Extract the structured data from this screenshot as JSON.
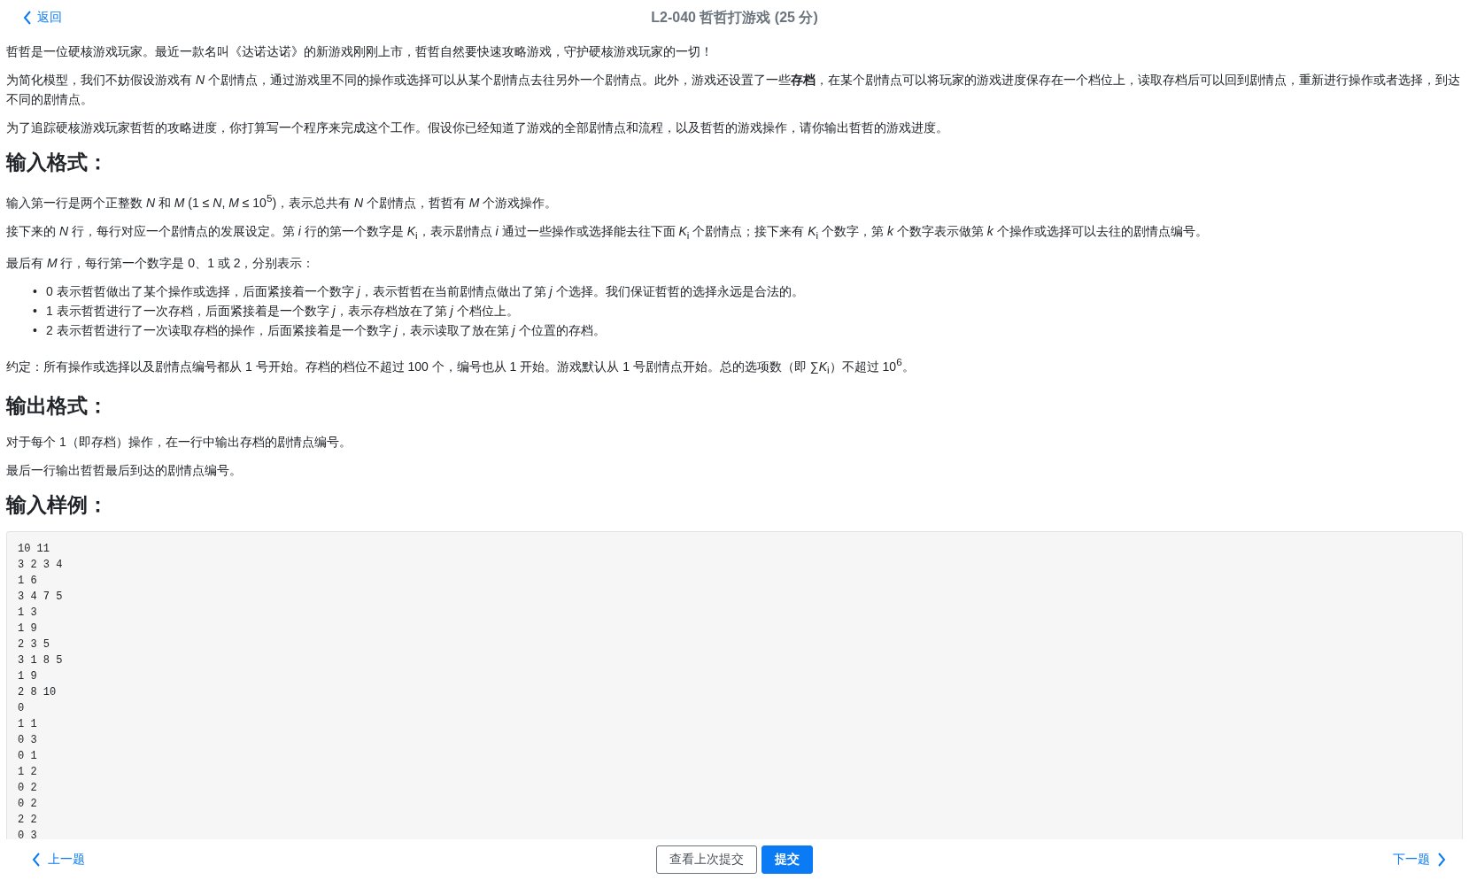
{
  "header": {
    "back": "返回",
    "title": "L2-040 哲哲打游戏 (25 分)"
  },
  "content": [
    {
      "kind": "paragraph",
      "text": "哲哲是一位硬核游戏玩家。最近一款名叫《达诺达诺》的新游戏刚刚上市，哲哲自然要快速攻略游戏，守护硬核游戏玩家的一切！"
    },
    {
      "kind": "paragraph",
      "text": "为简化模型，我们不妨假设游戏有 *N* 个剧情点，通过游戏里不同的操作或选择可以从某个剧情点去往另外一个剧情点。此外，游戏还设置了一些**存档**，在某个剧情点可以将玩家的游戏进度保存在一个档位上，读取存档后可以回到剧情点，重新进行操作或者选择，到达不同的剧情点。"
    },
    {
      "kind": "paragraph",
      "text": "为了追踪硬核游戏玩家哲哲的攻略进度，你打算写一个程序来完成这个工作。假设你已经知道了游戏的全部剧情点和流程，以及哲哲的游戏操作，请你输出哲哲的游戏进度。"
    },
    {
      "kind": "heading",
      "text": "输入格式："
    },
    {
      "kind": "paragraph",
      "text": "输入第一行是两个正整数 *N* 和 *M* (1 ≤ *N*, *M* ≤ 10$^{5}$)，表示总共有 *N* 个剧情点，哲哲有 *M* 个游戏操作。"
    },
    {
      "kind": "paragraph",
      "text": "接下来的 *N* 行，每行对应一个剧情点的发展设定。第 *i* 行的第一个数字是 *K*$_{i}$，表示剧情点 *i* 通过一些操作或选择能去往下面 *K*$_{i}$ 个剧情点；接下来有 *K*$_{i}$ 个数字，第 *k* 个数字表示做第 *k* 个操作或选择可以去往的剧情点编号。"
    },
    {
      "kind": "paragraph",
      "text": "最后有 *M* 行，每行第一个数字是 0、1 或 2，分别表示："
    },
    {
      "kind": "list",
      "marker": "•",
      "items": [
        "0 表示哲哲做出了某个操作或选择，后面紧接着一个数字 *j*，表示哲哲在当前剧情点做出了第 *j* 个选择。我们保证哲哲的选择永远是合法的。",
        "1 表示哲哲进行了一次存档，后面紧接着是一个数字 *j*，表示存档放在了第 *j* 个档位上。",
        "2 表示哲哲进行了一次读取存档的操作，后面紧接着是一个数字 *j*，表示读取了放在第 *j* 个位置的存档。"
      ]
    },
    {
      "kind": "paragraph",
      "text": "约定：所有操作或选择以及剧情点编号都从 1 号开始。存档的档位不超过 100 个，编号也从 1 开始。游戏默认从 1 号剧情点开始。总的选项数（即 ∑*K*$_{i}$）不超过 10$^{6}$。"
    },
    {
      "kind": "heading",
      "text": "输出格式："
    },
    {
      "kind": "paragraph",
      "text": "对于每个 1（即存档）操作，在一行中输出存档的剧情点编号。"
    },
    {
      "kind": "paragraph",
      "text": "最后一行输出哲哲最后到达的剧情点编号。"
    },
    {
      "kind": "heading",
      "text": "输入样例："
    },
    {
      "kind": "code",
      "text": "10 11\n3 2 3 4\n1 6\n3 4 7 5\n1 3\n1 9\n2 3 5\n3 1 8 5\n1 9\n2 8 10\n0\n1 1\n0 3\n0 1\n1 2\n0 2\n0 2\n2 2\n0 3"
    }
  ],
  "footer": {
    "prev": "上一题",
    "view_last": "查看上次提交",
    "submit": "提交",
    "next": "下一题"
  }
}
